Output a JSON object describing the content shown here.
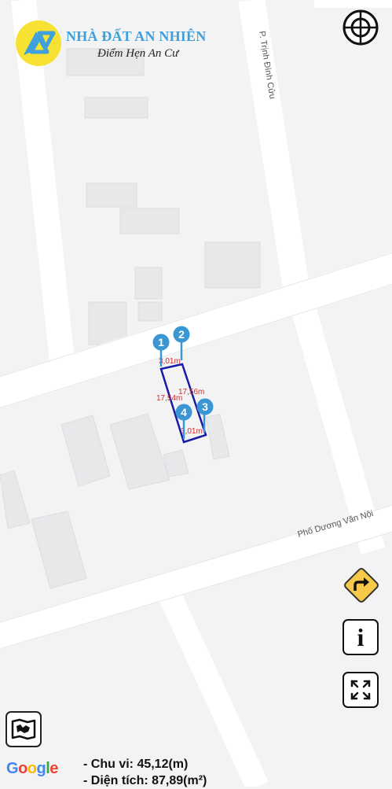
{
  "logo": {
    "name": "NHÀ ĐẤT AN NHIÊN",
    "slogan": "Điểm Hẹn An Cư"
  },
  "map": {
    "street_labels": [
      "P. Trịnh Đình Cửu",
      "Phố Dương Văn Nội"
    ],
    "markers": [
      {
        "number": "1",
        "label": "marker-1"
      },
      {
        "number": "2",
        "label": "marker-2"
      },
      {
        "number": "3",
        "label": "marker-3"
      },
      {
        "number": "4",
        "label": "marker-4"
      }
    ],
    "edge_lengths": [
      "3,01m",
      "17,56m",
      "17,54m",
      "3,01m"
    ],
    "colors": {
      "marker": "#3a97d4",
      "parcel_outline": "#1a1aa8",
      "dimension_text": "#d62e2e",
      "road": "#ffffff",
      "block": "#f3f3f4",
      "building": "#e7e8ea"
    }
  },
  "controls": {
    "info_label": "i"
  },
  "attribution": {
    "letters": [
      {
        "ch": "G",
        "color": "#4285f4"
      },
      {
        "ch": "o",
        "color": "#ea4335"
      },
      {
        "ch": "o",
        "color": "#fbbc05"
      },
      {
        "ch": "g",
        "color": "#4285f4"
      },
      {
        "ch": "l",
        "color": "#34a853"
      },
      {
        "ch": "e",
        "color": "#ea4335"
      }
    ]
  },
  "summary": {
    "perimeter": "- Chu vi: 45,12(m)",
    "area": "- Diện tích: 87,89(m²)"
  }
}
